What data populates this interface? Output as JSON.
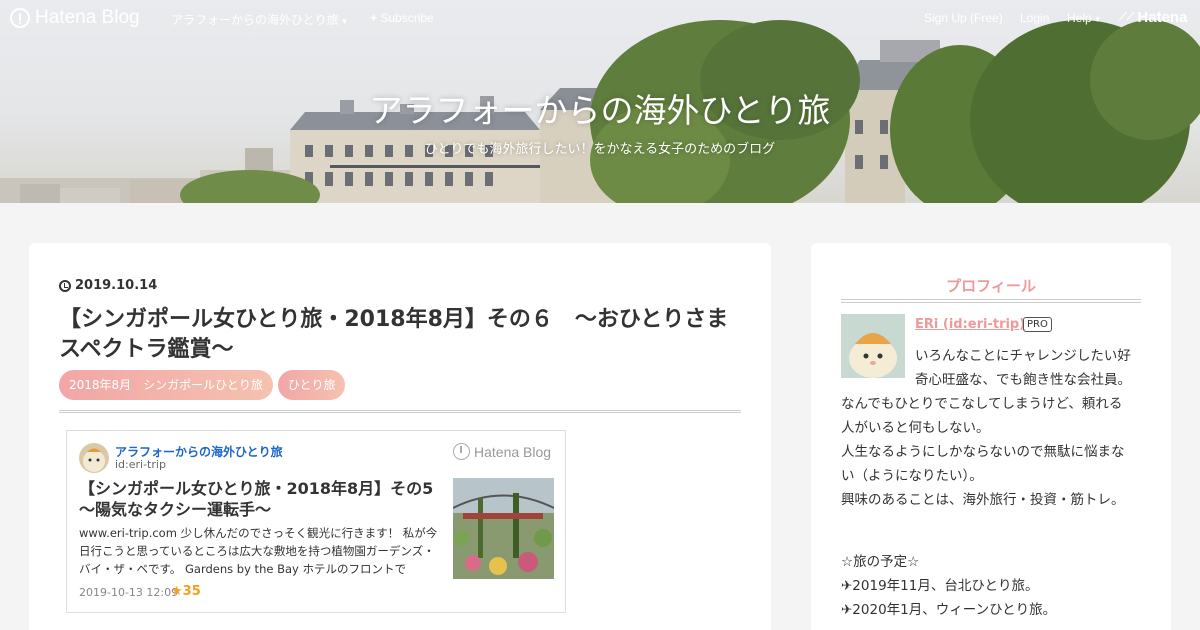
{
  "navbar": {
    "logo": "Hatena Blog",
    "blog_menu": "アラフォーからの海外ひとり旅",
    "subscribe": "Subscribe",
    "signup": "Sign Up (Free)",
    "login": "Login",
    "help": "Help",
    "brand": "Hatena"
  },
  "header": {
    "title": "アラフォーからの海外ひとり旅",
    "description": "ひとりでも海外旅行したい！をかなえる女子のためのブログ"
  },
  "entry": {
    "date": "2019.10.14",
    "title": "【シンガポール女ひとり旅・2018年8月】その６　～おひとりさまスペクトラ鑑賞～",
    "categories": [
      "2018年8月　シンガポールひとり旅",
      "ひとり旅"
    ]
  },
  "embed": {
    "blog_name": "アラフォーからの海外ひとり旅",
    "blog_id": "id:eri-trip",
    "logo": "Hatena Blog",
    "title": "【シンガポール女ひとり旅・2018年8月】その5　～陽気なタクシー運転手～",
    "excerpt": "www.eri-trip.com 少し休んだのでさっそく観光に行きます！ 私が今日行こうと思っているところは広大な敷地を持つ植物園ガーデンズ・バイ・ザ・ベです。 Gardens by the Bay ホテルのフロントで",
    "datetime": "2019-10-13 12:09",
    "stars": "★35"
  },
  "sidebar": {
    "heading": "プロフィール",
    "name": "ERi (id:eri-trip)",
    "badge": "PRO",
    "intro_1": "いろんなことにチャレンジしたい好",
    "intro_2": "奇心旺盛な、でも飽き性な会社員。",
    "bio_lines": [
      "なんでもひとりでこなしてしまうけど、頼れる",
      "人がいると何もしない。",
      "人生なるようにしかならないので無駄に悩まな",
      "い（ようになりたい）。",
      "興味のあることは、海外旅行・投資・筋トレ。"
    ],
    "plan_heading": "☆旅の予定☆",
    "plans": [
      "✈2019年11月、台北ひとり旅。",
      "✈2020年1月、ウィーンひとり旅。"
    ]
  },
  "colors": {
    "accent_pink": "#ee9a9a",
    "link_blue": "#1a66cc",
    "star_orange": "#f2a21a",
    "page_bg": "#f4f4f4"
  }
}
